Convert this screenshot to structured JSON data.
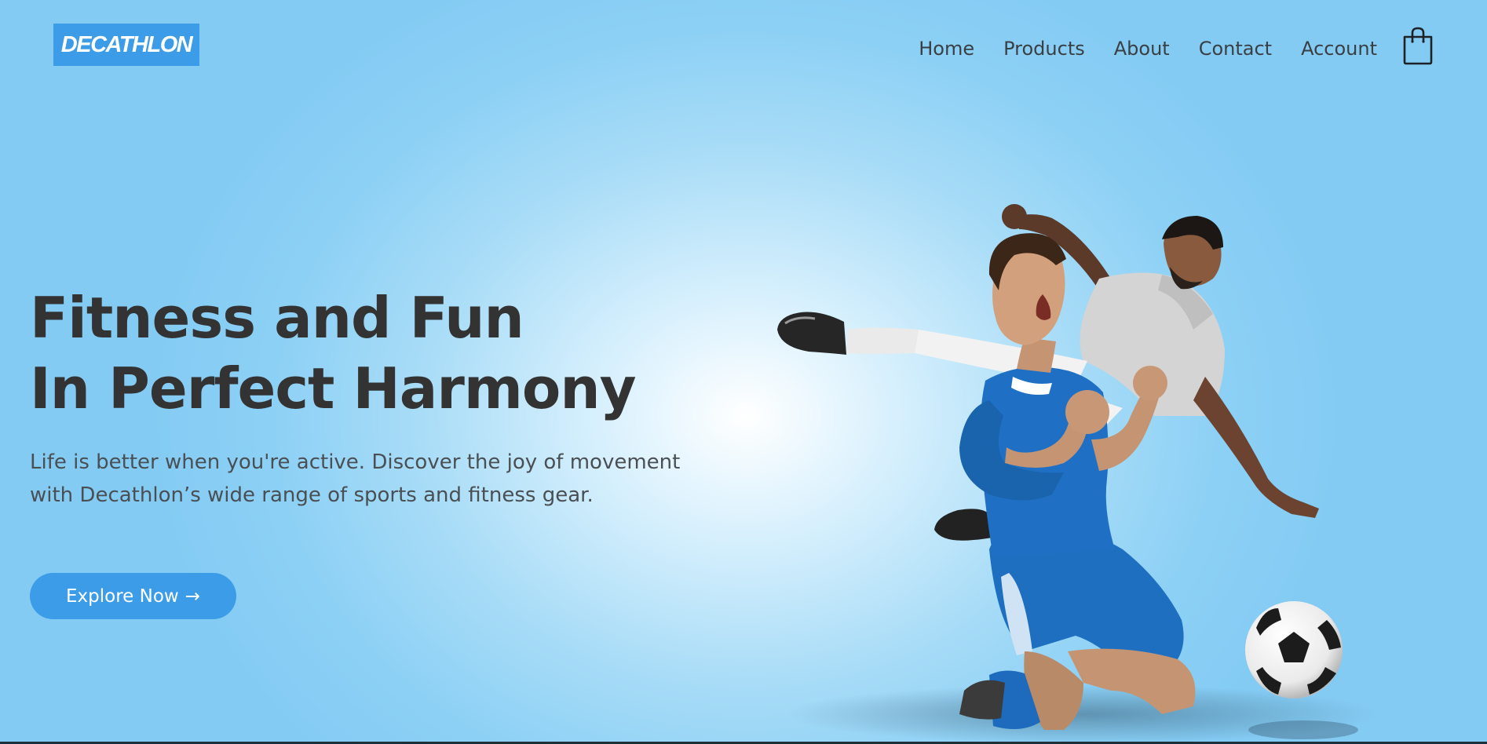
{
  "header": {
    "logo_text": "DECATHLON",
    "nav": [
      {
        "label": "Home"
      },
      {
        "label": "Products"
      },
      {
        "label": "About"
      },
      {
        "label": "Contact"
      },
      {
        "label": "Account"
      }
    ],
    "cart_icon": "shopping-bag-icon"
  },
  "hero": {
    "headline_line1": "Fitness and Fun",
    "headline_line2": "In Perfect Harmony",
    "subtext_line1": "Life is better when you're active. Discover the joy of movement",
    "subtext_line2": "with Decathlon’s wide range of sports and fitness gear.",
    "cta_label": "Explore Now",
    "cta_arrow": "→"
  },
  "colors": {
    "brand": "#3c9ce8",
    "text_dark": "#333333",
    "background": "#8cd0f5"
  }
}
